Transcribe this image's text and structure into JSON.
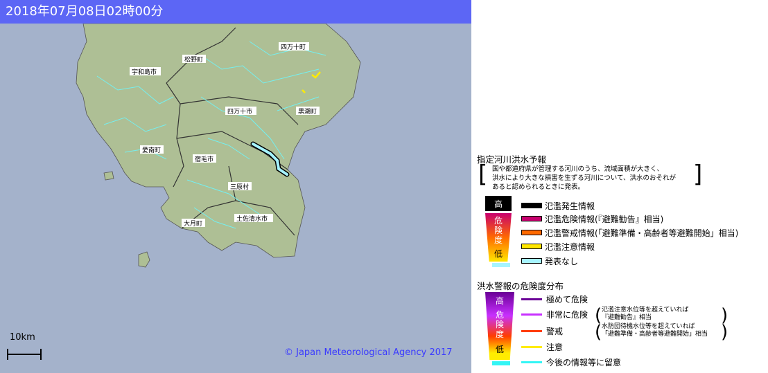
{
  "header": {
    "datetime": "2018年07月08日02時00分"
  },
  "map": {
    "scale_label": "10km",
    "copyright": "© Japan Meteorological Agency 2017",
    "municipalities": [
      "四万十町",
      "松野町",
      "宇和島市",
      "四万十市",
      "黒潮町",
      "愛南町",
      "宿毛市",
      "三原村",
      "大月町",
      "土佐清水市"
    ]
  },
  "legend": {
    "river_forecast": {
      "title": "指定河川洪水予報",
      "note_lines": [
        "国や都道府県が管理する河川のうち、流域面積が大きく、",
        "洪水により大きな損害を生ずる河川について、洪水のおそれが",
        "あると認められるときに発表。"
      ],
      "scale_high": "高",
      "scale_mid": [
        "危",
        "険",
        "度"
      ],
      "scale_low": "低",
      "items": [
        {
          "label": "氾濫発生情報",
          "color": "#000000"
        },
        {
          "label": "氾濫危険情報(『避難勧告』相当)",
          "color": "#c8006e"
        },
        {
          "label": "氾濫警戒情報(「避難準備・高齢者等避難開始」相当)",
          "color": "#ff6a00"
        },
        {
          "label": "氾濫注意情報",
          "color": "#ffe600"
        },
        {
          "label": "発表なし",
          "color": "#a6f4ff"
        }
      ]
    },
    "flood_warning": {
      "title": "洪水警報の危険度分布",
      "scale_high": "高",
      "scale_mid": [
        "危",
        "険",
        "度"
      ],
      "scale_low": "低",
      "items": [
        {
          "label": "極めて危険",
          "color": "#6a0096"
        },
        {
          "label": "非常に危険",
          "color": "#c830ff"
        },
        {
          "label": "警戒",
          "color": "#ff3c00"
        },
        {
          "label": "注意",
          "color": "#ffec00"
        },
        {
          "label": "今後の情報等に留意",
          "color": "#33f5f5"
        }
      ],
      "note_very_high": [
        "氾濫注意水位等を超えていれば",
        "『避難勧告』相当"
      ],
      "note_warning": [
        "水防団待機水位等を超えていれば",
        "「避難準備・高齢者等避難開始」相当"
      ]
    }
  }
}
